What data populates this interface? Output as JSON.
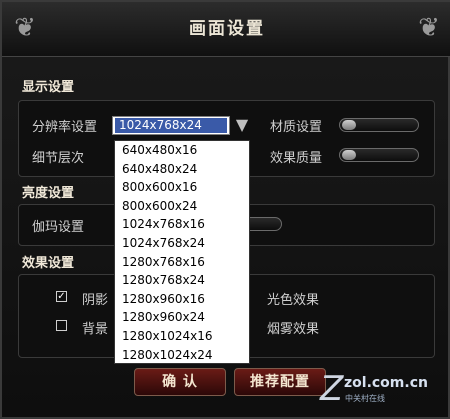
{
  "window": {
    "title": "画面设置"
  },
  "sections": {
    "display": "显示设置",
    "brightness": "亮度设置",
    "effects": "效果设置"
  },
  "display": {
    "resolution_label": "分辨率设置",
    "resolution_value": "1024x768x24",
    "detail_label": "细节层次",
    "texture_label": "材质设置",
    "quality_label": "效果质量"
  },
  "brightness": {
    "gamma_label": "伽玛设置"
  },
  "effects": {
    "shadow_label": "阴影",
    "shadow_checked": true,
    "background_label": "背景",
    "background_checked": false,
    "light_label": "光色效果",
    "fog_label": "烟雾效果"
  },
  "dropdown": {
    "options": [
      "640x480x16",
      "640x480x24",
      "800x600x16",
      "800x600x24",
      "1024x768x16",
      "1024x768x24",
      "1280x768x16",
      "1280x768x24",
      "1280x960x16",
      "1280x960x24",
      "1280x1024x16",
      "1280x1024x24"
    ]
  },
  "buttons": {
    "confirm": "确  认",
    "recommended": "推荐配置"
  },
  "watermark": {
    "site": "zol.com.cn",
    "sub": "中关村在线"
  }
}
